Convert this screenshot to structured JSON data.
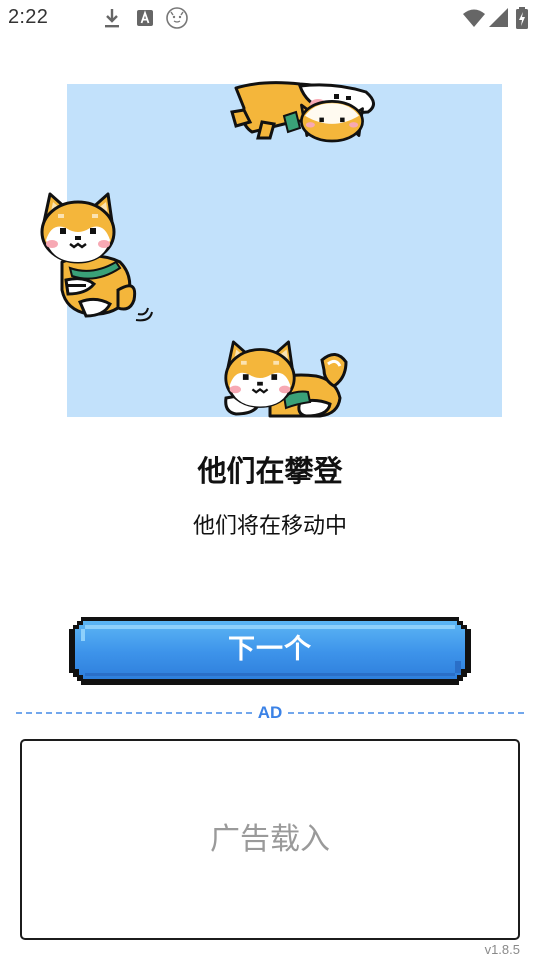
{
  "status_bar": {
    "time": "2:22",
    "notification_icons": [
      "download-icon",
      "a-letter-icon",
      "shiba-app-icon"
    ],
    "system_icons": [
      "wifi-icon",
      "cellular-signal-icon",
      "battery-charging-icon"
    ]
  },
  "illustration": {
    "background": "#c2e1fb",
    "subjects": [
      "shiba-dog-flying",
      "shiba-dog-running",
      "shiba-dog-lying"
    ]
  },
  "content": {
    "title": "他们在攀登",
    "subtitle": "他们将在移动中"
  },
  "actions": {
    "next_label": "下一个"
  },
  "ad": {
    "divider_label": "AD",
    "placeholder": "广告载入"
  },
  "footer": {
    "version": "v1.8.5"
  },
  "colors": {
    "button_blue": "#3d93ea",
    "ad_accent": "#3b82e6",
    "fur_orange": "#f4b63b"
  }
}
